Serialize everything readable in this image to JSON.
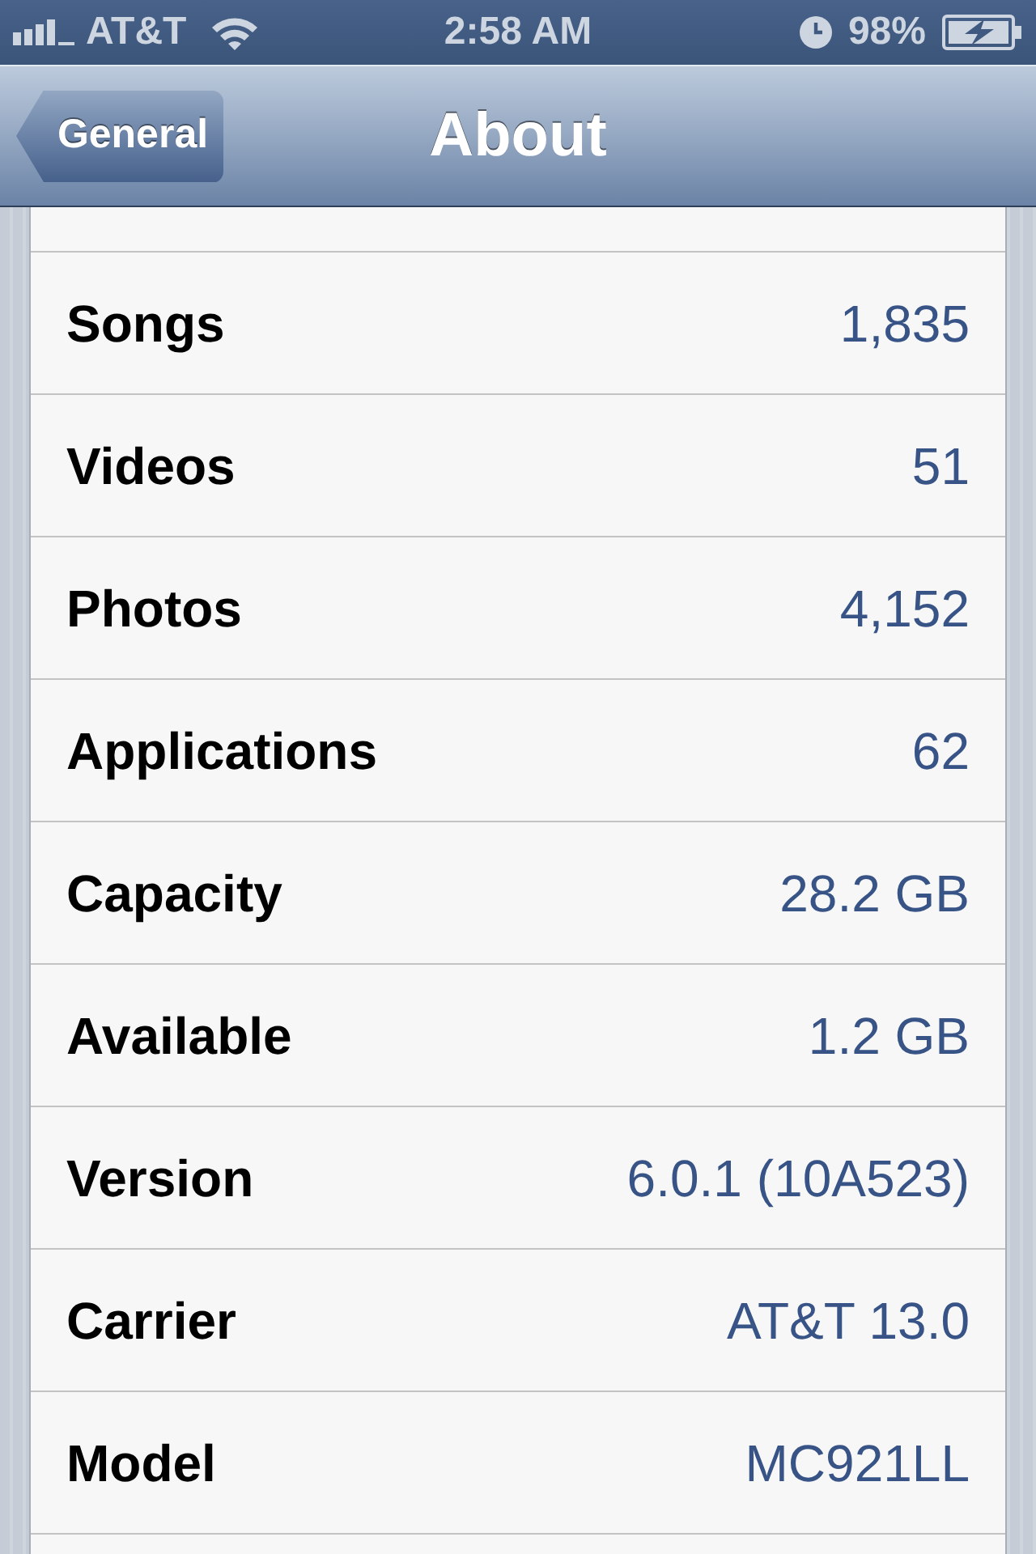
{
  "status_bar": {
    "carrier": "AT&T",
    "time": "2:58 AM",
    "battery": "98%"
  },
  "nav_bar": {
    "back_button": "General",
    "title": "About"
  },
  "rows": [
    {
      "label": "Songs",
      "value": "1,835"
    },
    {
      "label": "Videos",
      "value": "51"
    },
    {
      "label": "Photos",
      "value": "4,152"
    },
    {
      "label": "Applications",
      "value": "62"
    },
    {
      "label": "Capacity",
      "value": "28.2 GB"
    },
    {
      "label": "Available",
      "value": "1.2 GB"
    },
    {
      "label": "Version",
      "value": "6.0.1 (10A523)"
    },
    {
      "label": "Carrier",
      "value": "AT&T 13.0"
    },
    {
      "label": "Model",
      "value": "MC921LL"
    }
  ]
}
